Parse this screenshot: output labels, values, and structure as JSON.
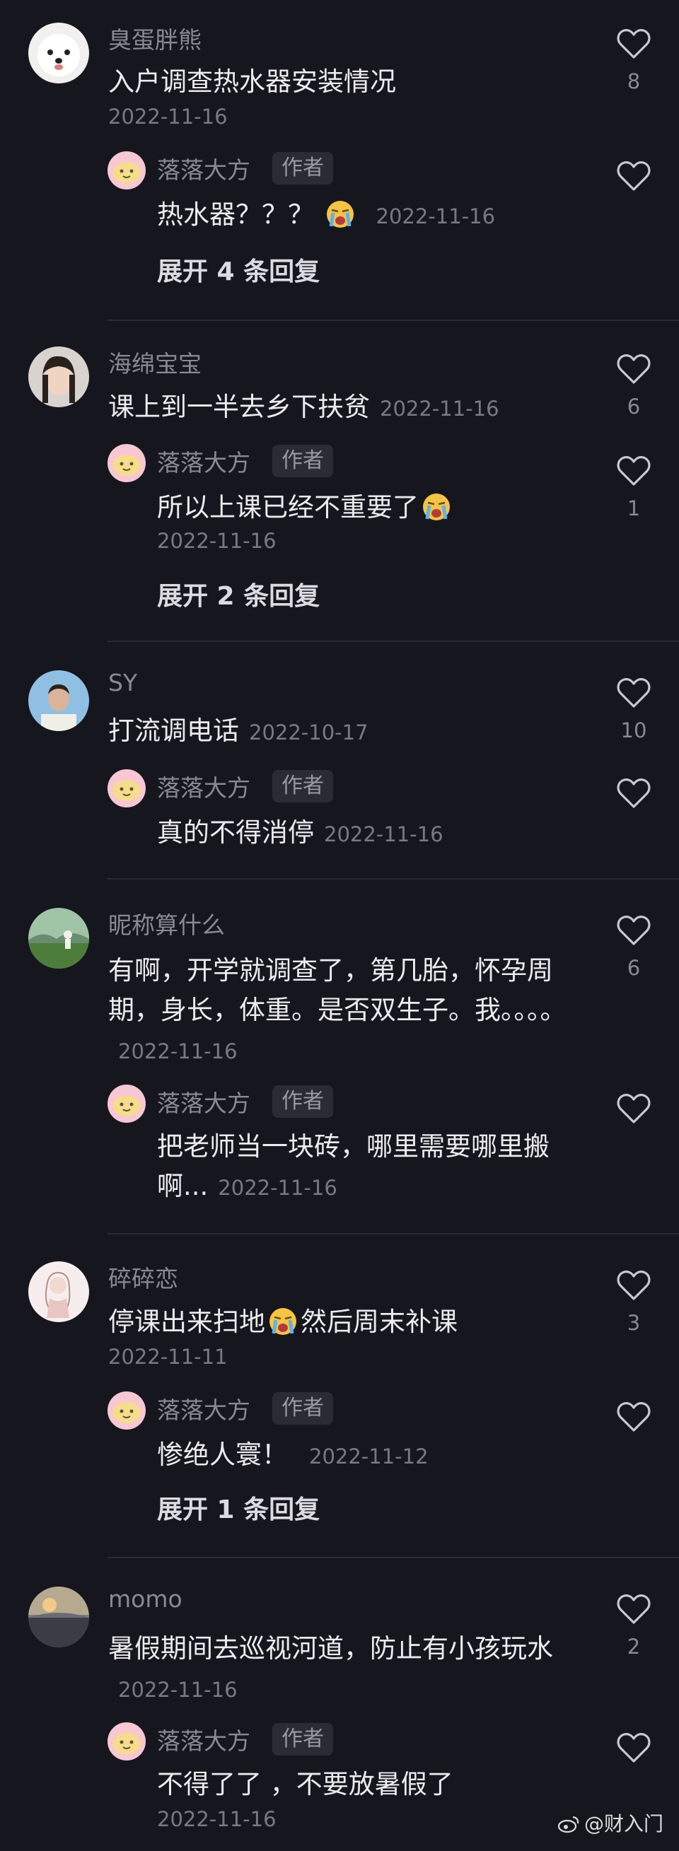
{
  "reply_author": "落落大方",
  "author_badge": "作者",
  "threads": [
    {
      "main": {
        "user": "臭蛋胖熊",
        "text": "入户调查热水器安装情况",
        "date": "2022-11-16",
        "likes": "8"
      },
      "replies": [
        {
          "text": "热水器？？？",
          "date": "2022-11-16",
          "likes": ""
        }
      ],
      "expand": "展开 4 条回复"
    },
    {
      "main": {
        "user": "海绵宝宝",
        "text": "课上到一半去乡下扶贫",
        "date": "2022-11-16",
        "likes": "6"
      },
      "replies": [
        {
          "text": "所以上课已经不重要了",
          "date": "2022-11-16",
          "likes": "1"
        }
      ],
      "expand": "展开 2 条回复"
    },
    {
      "main": {
        "user": "SY",
        "text": "打流调电话",
        "date": "2022-10-17",
        "likes": "10"
      },
      "replies": [
        {
          "text": "真的不得消停",
          "date": "2022-11-16",
          "likes": ""
        }
      ],
      "expand": ""
    },
    {
      "main": {
        "user": "昵称算什么",
        "text": "有啊，开学就调查了，第几胎，怀孕周期，身长，体重。是否双生子。我。。。。",
        "date": "2022-11-16",
        "likes": "6"
      },
      "replies": [
        {
          "text": "把老师当一块砖，哪里需要哪里搬啊...",
          "date": "2022-11-16",
          "likes": ""
        }
      ],
      "expand": ""
    },
    {
      "main": {
        "user": "碎碎恋",
        "text": "停课出来扫地",
        "text_after": "然后周末补课",
        "date": "2022-11-11",
        "likes": "3"
      },
      "replies": [
        {
          "text": "惨绝人寰！",
          "date": "2022-11-12",
          "likes": ""
        }
      ],
      "expand": "展开 1 条回复"
    },
    {
      "main": {
        "user": "momo",
        "text": "暑假期间去巡视河道，防止有小孩玩水",
        "date": "2022-11-16",
        "likes": "2"
      },
      "replies": [
        {
          "text": "不得了了 ，不要放暑假了",
          "date": "2022-11-16",
          "likes": ""
        }
      ],
      "expand": ""
    }
  ],
  "watermark": "@财入门",
  "colors": {
    "background": "#16161e",
    "text": "#ecebef",
    "muted": "#8a8992"
  }
}
